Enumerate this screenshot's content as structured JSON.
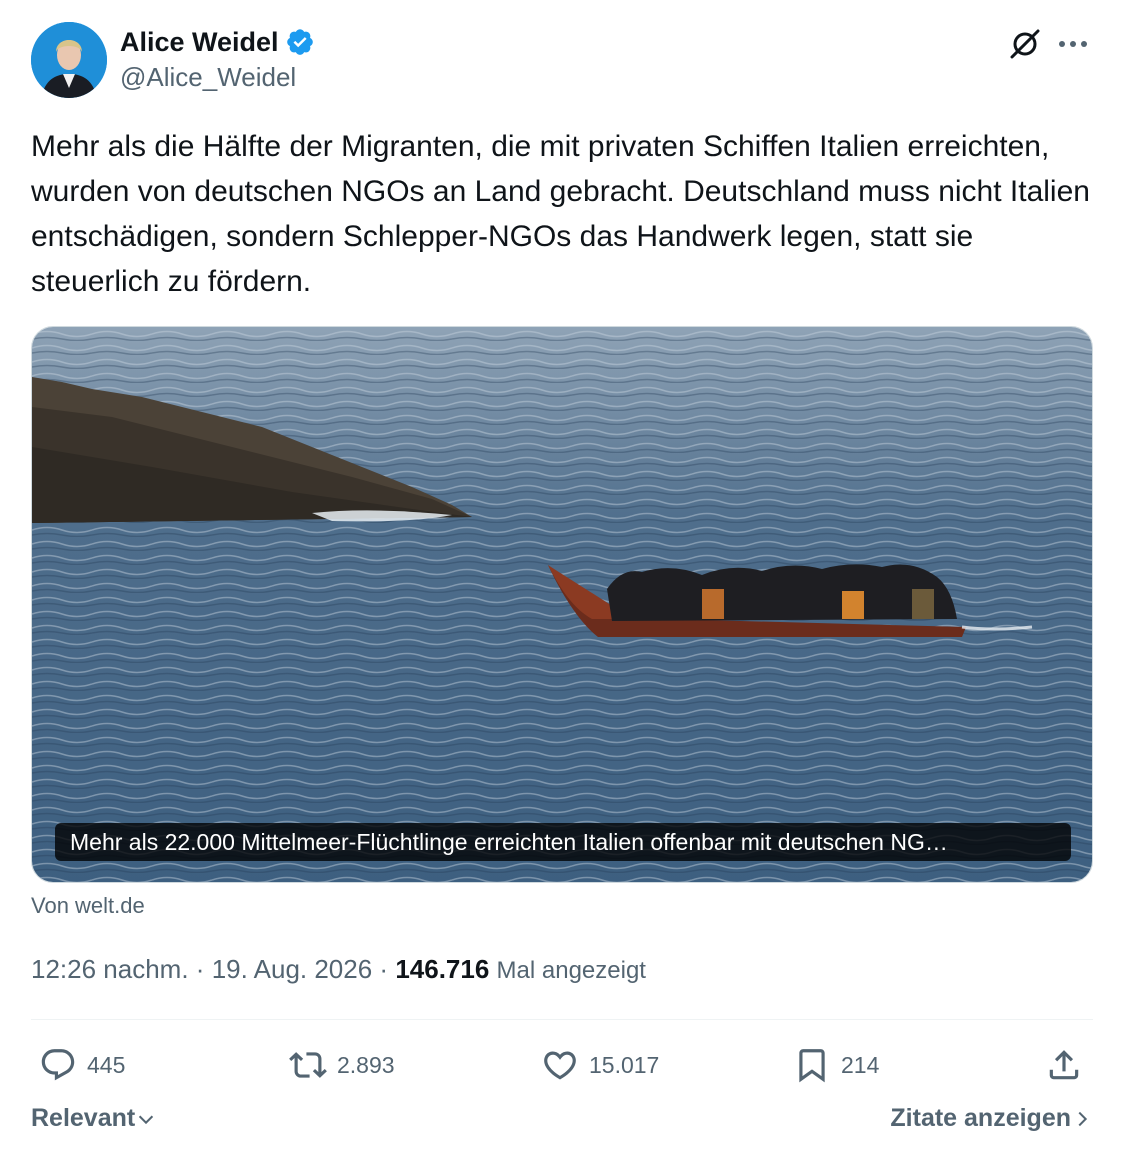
{
  "author": {
    "display_name": "Alice Weidel",
    "handle": "@Alice_Weidel",
    "verified": true,
    "avatar_icon": "avatar-photo"
  },
  "header_icons": {
    "grok": "grok-icon",
    "more": "more-icon"
  },
  "tweet": {
    "text": "Mehr als die Hälfte der Migranten, die mit privaten Schiffen Italien erreichten, wurden von deutschen NGOs an Land gebracht. Deutschland muss nicht Italien entschädigen, sondern Schlepper-NGOs das Handwerk legen, statt sie steuerlich zu fördern."
  },
  "link_card": {
    "title": "Mehr als 22.000 Mittelmeer-Flüchtlinge erreichten Italien offenbar mit deutschen NG…",
    "source": "Von welt.de"
  },
  "meta": {
    "time": "12:26 nachm.",
    "date": "19. Aug. 2026",
    "separator": "·",
    "views": "146.716",
    "views_label": "Mal angezeigt"
  },
  "actions": {
    "replies": "445",
    "reposts": "2.893",
    "likes": "15.017",
    "bookmarks": "214"
  },
  "footer": {
    "sort_label": "Relevant",
    "quotes_label": "Zitate anzeigen"
  },
  "colors": {
    "verified": "#1d9bf0",
    "secondary_text": "#536471",
    "primary_text": "#0f1419"
  }
}
